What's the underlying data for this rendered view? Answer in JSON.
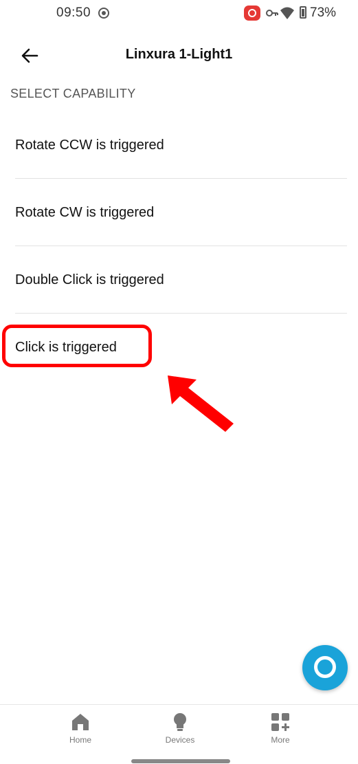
{
  "status_bar": {
    "time": "09:50",
    "battery": "73%"
  },
  "header": {
    "title": "Linxura 1-Light1",
    "back_icon": "arrow-left-icon"
  },
  "section_title": "SELECT CAPABILITY",
  "capabilities": [
    {
      "label": "Rotate CCW is triggered"
    },
    {
      "label": "Rotate CW is triggered"
    },
    {
      "label": "Double Click is triggered"
    },
    {
      "label": "Click is triggered",
      "highlighted": true
    }
  ],
  "annotation": {
    "color": "#ff0000"
  },
  "fab": {
    "icon": "alexa-icon",
    "color": "#1aa3d9"
  },
  "bottom_nav": [
    {
      "label": "Home",
      "icon": "home-icon"
    },
    {
      "label": "Devices",
      "icon": "lightbulb-icon"
    },
    {
      "label": "More",
      "icon": "grid-plus-icon"
    }
  ]
}
